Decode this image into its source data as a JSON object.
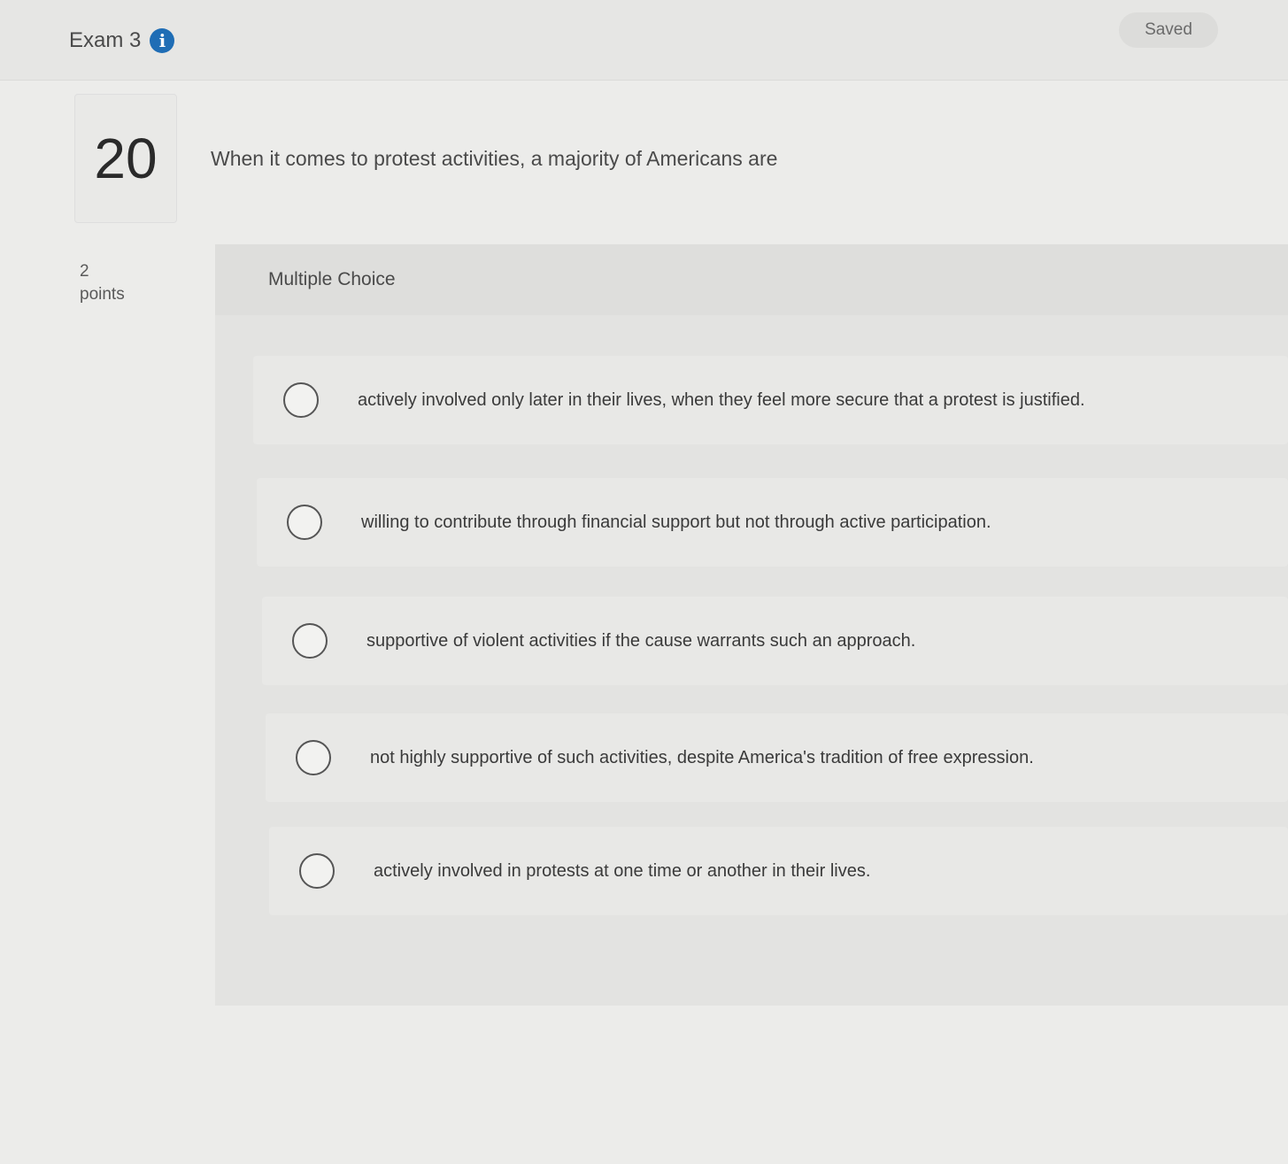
{
  "header": {
    "exam_title": "Exam 3",
    "info_icon": "info-icon",
    "status": "Saved"
  },
  "question": {
    "number": "20",
    "text": "When it comes to protest activities, a majority of Americans are",
    "points_value": "2",
    "points_label": "points",
    "type_label": "Multiple Choice",
    "options": [
      {
        "text": "actively involved only later in their lives, when they feel more secure that a protest is justified."
      },
      {
        "text": "willing to contribute through financial support but not through active participation."
      },
      {
        "text": "supportive of violent activities if the cause warrants such an approach."
      },
      {
        "text": "not highly supportive of such activities, despite America's tradition of free expression."
      },
      {
        "text": "actively involved in protests at one time or another in their lives."
      }
    ]
  },
  "colors": {
    "info_icon": "#1f6db5",
    "background": "#ececea"
  }
}
